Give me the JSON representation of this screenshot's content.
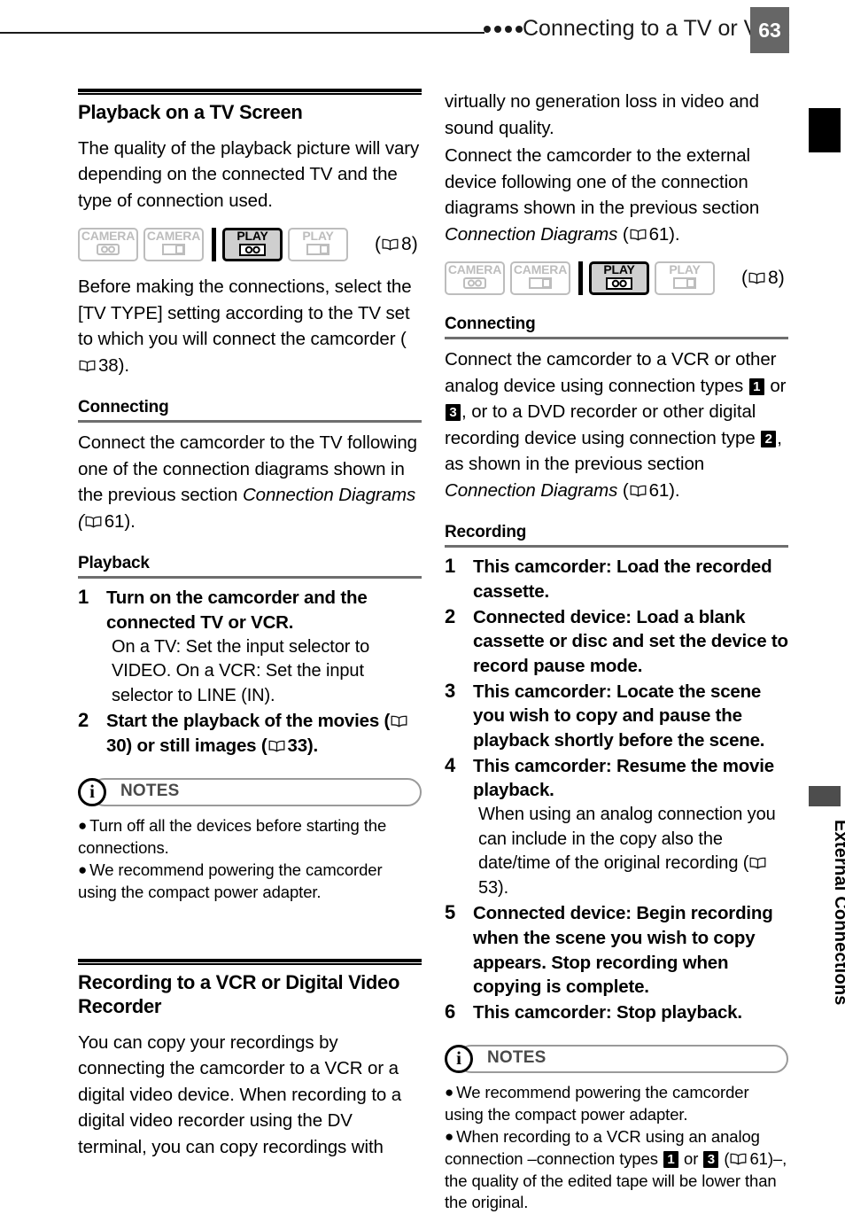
{
  "header": {
    "title": "Connecting to a TV or VCR",
    "page_number": "63"
  },
  "side_tab": {
    "label": "External Connections"
  },
  "left_column": {
    "section_title": "Playback on a TV Screen",
    "intro": "The quality of the playback picture will vary depending on the connected TV and the type of connection used.",
    "mode_icons": {
      "chips": [
        {
          "label": "CAMERA",
          "sub": "tape",
          "state": "inactive"
        },
        {
          "label": "CAMERA",
          "sub": "card",
          "state": "inactive"
        },
        {
          "label": "PLAY",
          "sub": "tape",
          "state": "active"
        },
        {
          "label": "PLAY",
          "sub": "card",
          "state": "inactive"
        }
      ],
      "page_ref": "8"
    },
    "before_text_a": "Before making the connections, select the [TV TYPE] setting according to the TV set to which you will connect the camcorder (",
    "before_text_ref": "38",
    "before_text_b": ").",
    "connecting": {
      "heading": "Connecting",
      "text_a": "Connect the camcorder to the TV following one of the connection diagrams shown in the previous section ",
      "text_italic": "Connection Diagrams",
      "text_b": " (",
      "page_ref": "61",
      "text_c": ")."
    },
    "playback": {
      "heading": "Playback",
      "steps": [
        {
          "num": "1",
          "bold": "Turn on the camcorder and the connected TV or VCR.",
          "note": "On a TV: Set the input selector to VIDEO. On a VCR: Set the input selector to LINE (IN)."
        },
        {
          "num": "2",
          "bold_a": "Start the playback of the movies (",
          "ref_a": "30",
          "bold_b": ") or still images (",
          "ref_b": "33",
          "bold_c": ")."
        }
      ]
    },
    "notes": {
      "label": "NOTES",
      "icon": "i",
      "items": [
        "Turn off all the devices before starting the connections.",
        "We recommend powering the camcorder using the compact power adapter."
      ]
    },
    "section2_title": "Recording to a VCR or Digital Video Recorder",
    "section2_text": "You can copy your recordings by connecting the camcorder to a VCR or a digital video device. When recording to a digital video recorder using the DV terminal, you can copy recordings with"
  },
  "right_column": {
    "continuation_a": "virtually no generation loss in video and sound quality.",
    "continuation_b_a": "Connect the camcorder to the external device following one of the connection diagrams shown in the previous section ",
    "continuation_b_italic": "Connection Diagrams",
    "continuation_b_mid": " (",
    "continuation_b_ref": "61",
    "continuation_b_end": ").",
    "mode_icons": {
      "chips": [
        {
          "label": "CAMERA",
          "sub": "tape",
          "state": "inactive"
        },
        {
          "label": "CAMERA",
          "sub": "card",
          "state": "inactive"
        },
        {
          "label": "PLAY",
          "sub": "tape",
          "state": "active"
        },
        {
          "label": "PLAY",
          "sub": "card",
          "state": "inactive"
        }
      ],
      "page_ref": "8"
    },
    "connecting": {
      "heading": "Connecting",
      "t1": "Connect the camcorder to a VCR or other analog device using connection types ",
      "type1": "1",
      "t2": " or ",
      "type3": "3",
      "t3": ", or to a DVD recorder or other digital recording device using connection type ",
      "type2": "2",
      "t4": ", as shown in the previous section ",
      "italic": "Connection Diagrams",
      "t5": " (",
      "page_ref": "61",
      "t6": ")."
    },
    "recording": {
      "heading": "Recording",
      "steps": [
        {
          "num": "1",
          "bold": "This camcorder: Load the recorded cassette."
        },
        {
          "num": "2",
          "bold": "Connected device: Load a blank cassette or disc and set the device to record pause mode."
        },
        {
          "num": "3",
          "bold": "This camcorder: Locate the scene you wish to copy and pause the playback shortly before the scene."
        },
        {
          "num": "4",
          "bold": "This camcorder: Resume the movie playback.",
          "note_a": "When using an analog connection you can include in the copy also the date/time of the original recording (",
          "note_ref": "53",
          "note_b": ")."
        },
        {
          "num": "5",
          "bold": "Connected device: Begin recording when the scene you wish to copy appears. Stop recording when copying is complete."
        },
        {
          "num": "6",
          "bold": "This camcorder: Stop playback."
        }
      ]
    },
    "notes": {
      "label": "NOTES",
      "icon": "i",
      "item1": "We recommend powering the camcorder using the compact power adapter.",
      "item2_a": "When recording to a VCR using an analog connection –connection types ",
      "item2_type1": "1",
      "item2_mid": " or ",
      "item2_type3": "3",
      "item2_paren": " (",
      "item2_ref": "61",
      "item2_b": ")–, the quality of the edited tape will be lower than the original."
    }
  },
  "colors": {
    "page_box_bg": "#666666",
    "sub_rule": "#6e6e6e",
    "inactive_icon": "#bdbdbd",
    "active_icon_bg": "#cfcfcf",
    "notes_frame": "#9a9a9a"
  }
}
